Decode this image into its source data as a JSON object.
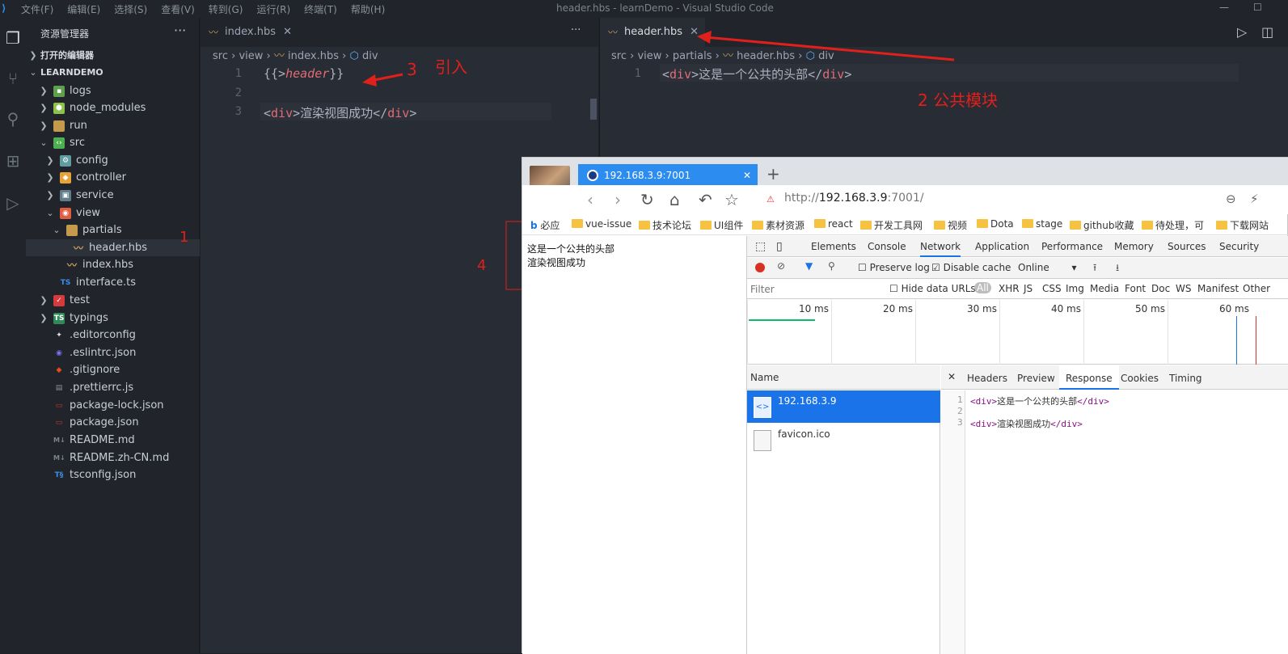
{
  "titlebar": {
    "menus": [
      "文件(F)",
      "编辑(E)",
      "选择(S)",
      "查看(V)",
      "转到(G)",
      "运行(R)",
      "终端(T)",
      "帮助(H)"
    ],
    "title": "header.hbs - learnDemo - Visual Studio Code"
  },
  "explorer": {
    "heading": "资源管理器",
    "more": "···",
    "open_editors": "打开的编辑器",
    "project": "LEARNDEMO",
    "items": [
      {
        "label": "logs",
        "icon": "folder-logs-icon"
      },
      {
        "label": "node_modules",
        "icon": "folder-node-icon"
      },
      {
        "label": "run",
        "icon": "folder-icon"
      },
      {
        "label": "src",
        "icon": "folder-src-icon"
      },
      {
        "label": "config",
        "icon": "folder-config-icon"
      },
      {
        "label": "controller",
        "icon": "folder-controller-icon"
      },
      {
        "label": "service",
        "icon": "folder-service-icon"
      },
      {
        "label": "view",
        "icon": "folder-view-icon"
      },
      {
        "label": "partials",
        "icon": "folder-open-icon"
      },
      {
        "label": "header.hbs",
        "icon": "handlebars-icon"
      },
      {
        "label": "index.hbs",
        "icon": "handlebars-icon"
      },
      {
        "label": "interface.ts",
        "icon": "typescript-icon"
      },
      {
        "label": "test",
        "icon": "folder-test-icon"
      },
      {
        "label": "typings",
        "icon": "folder-typings-icon"
      },
      {
        "label": ".editorconfig",
        "icon": "editorconfig-icon"
      },
      {
        "label": ".eslintrc.json",
        "icon": "eslint-icon"
      },
      {
        "label": ".gitignore",
        "icon": "git-icon"
      },
      {
        "label": ".prettierrc.js",
        "icon": "prettier-icon"
      },
      {
        "label": "package-lock.json",
        "icon": "npm-icon"
      },
      {
        "label": "package.json",
        "icon": "npm-icon"
      },
      {
        "label": "README.md",
        "icon": "markdown-icon"
      },
      {
        "label": "README.zh-CN.md",
        "icon": "markdown-icon"
      },
      {
        "label": "tsconfig.json",
        "icon": "tsconfig-icon"
      }
    ]
  },
  "editor_left": {
    "tab": "index.hbs",
    "breadcrumb": [
      "src",
      "view",
      "index.hbs",
      "div"
    ],
    "line_numbers": [
      "1",
      "2",
      "3"
    ],
    "line1_open": "{{>",
    "line1_partial": "header",
    "line1_close": "}}",
    "line3_open_tag": "div",
    "line3_text": "渲染视图成功",
    "line3_close_tag": "div"
  },
  "editor_right": {
    "tab": "header.hbs",
    "breadcrumb": [
      "src",
      "view",
      "partials",
      "header.hbs",
      "div"
    ],
    "line_numbers": [
      "1"
    ],
    "line1_open_tag": "div",
    "line1_text": "这是一个公共的头部",
    "line1_close_tag": "div"
  },
  "annotations": {
    "a1": "1",
    "a2": "2 公共模块",
    "a3": "3",
    "a3_text": "引入",
    "a4": "4"
  },
  "browser": {
    "tab_title": "192.168.3.9:7001",
    "url_prefix": "http://",
    "url_host": "192.168.3.9",
    "url_suffix": ":7001/",
    "bookmarks": [
      "必应",
      "vue-issue",
      "技术论坛",
      "UI组件",
      "素材资源",
      "react",
      "开发工具网",
      "视频",
      "Dota",
      "stage",
      "github收藏",
      "待处理，可",
      "下载网站"
    ],
    "page_line1": "这是一个公共的头部",
    "page_line2": "渲染视图成功"
  },
  "devtools": {
    "tabs": [
      "Elements",
      "Console",
      "Network",
      "Application",
      "Performance",
      "Memory",
      "Sources",
      "Security"
    ],
    "active_tab": "Network",
    "preserve_log": "Preserve log",
    "disable_cache": "Disable cache",
    "throttle": "Online",
    "filter_placeholder": "Filter",
    "hide_data_urls": "Hide data URLs",
    "types": [
      "All",
      "XHR",
      "JS",
      "CSS",
      "Img",
      "Media",
      "Font",
      "Doc",
      "WS",
      "Manifest",
      "Other"
    ],
    "timeline_ticks": [
      "10 ms",
      "20 ms",
      "30 ms",
      "40 ms",
      "50 ms",
      "60 ms"
    ],
    "name_header": "Name",
    "requests": [
      "192.168.3.9",
      "favicon.ico"
    ],
    "detail_tabs": [
      "Headers",
      "Preview",
      "Response",
      "Cookies",
      "Timing"
    ],
    "active_detail": "Response",
    "response_lines": [
      "1",
      "2",
      "3"
    ],
    "resp1_text": "这是一个公共的头部",
    "resp3_text": "渲染视图成功",
    "resp_open": "<div>",
    "resp_close": "</div>"
  }
}
